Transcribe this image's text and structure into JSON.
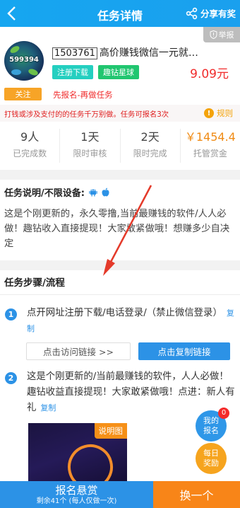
{
  "header": {
    "title": "任务详情",
    "share_label": "分享有奖"
  },
  "task": {
    "avatar_id": "599394",
    "id": "1503761",
    "title": "高价赚钱微信一元就…",
    "tags": [
      "注册下载",
      "趣钻星球"
    ],
    "price": "9.09元",
    "report_label": "举报",
    "follow_label": "关注",
    "repeat_note": "先报名-再做任务"
  },
  "warning": {
    "text": "打钱或涉及支付的的任务千万别做。任务可报名3次",
    "rule_label": "规则"
  },
  "stats": [
    {
      "value": "9人",
      "label": "已完成数"
    },
    {
      "value": "1天",
      "label": "限时审核"
    },
    {
      "value": "2天",
      "label": "限时完成"
    },
    {
      "value": "￥1454.4",
      "label": "托管赏金"
    }
  ],
  "description": {
    "title": "任务说明/不限设备:",
    "text": "这是个刚更新的，永久零撸,当前最赚钱的软件/人人必做！趣钻收入直接提现！大家敢紧做哦！想赚多少自决定"
  },
  "steps": {
    "title": "任务步骤/流程",
    "items": [
      {
        "no": "1",
        "text": "点开网址注册下载/电话登录/（禁止微信登录）",
        "copy": "复制"
      },
      {
        "no": "2",
        "text": "这是个刚更新的/当前最赚钱的软件，人人必做！趣钻收益直接提现！大家敢紧做哦！点进：新人有礼",
        "copy": "复制"
      }
    ],
    "visit_link": "点击访问链接 >>",
    "copy_link": "点击复制链接",
    "demo_label": "说明图"
  },
  "float": {
    "mine": "我的报名",
    "mine_badge": "0",
    "daily": "每日奖励"
  },
  "bottom": {
    "apply": "报名悬赏",
    "remaining": "剩余41个 (每人仅做一次)",
    "change": "换一个"
  },
  "colors": {
    "primary": "#2c92e6",
    "accent": "#f88518",
    "danger": "#f02c2c"
  }
}
